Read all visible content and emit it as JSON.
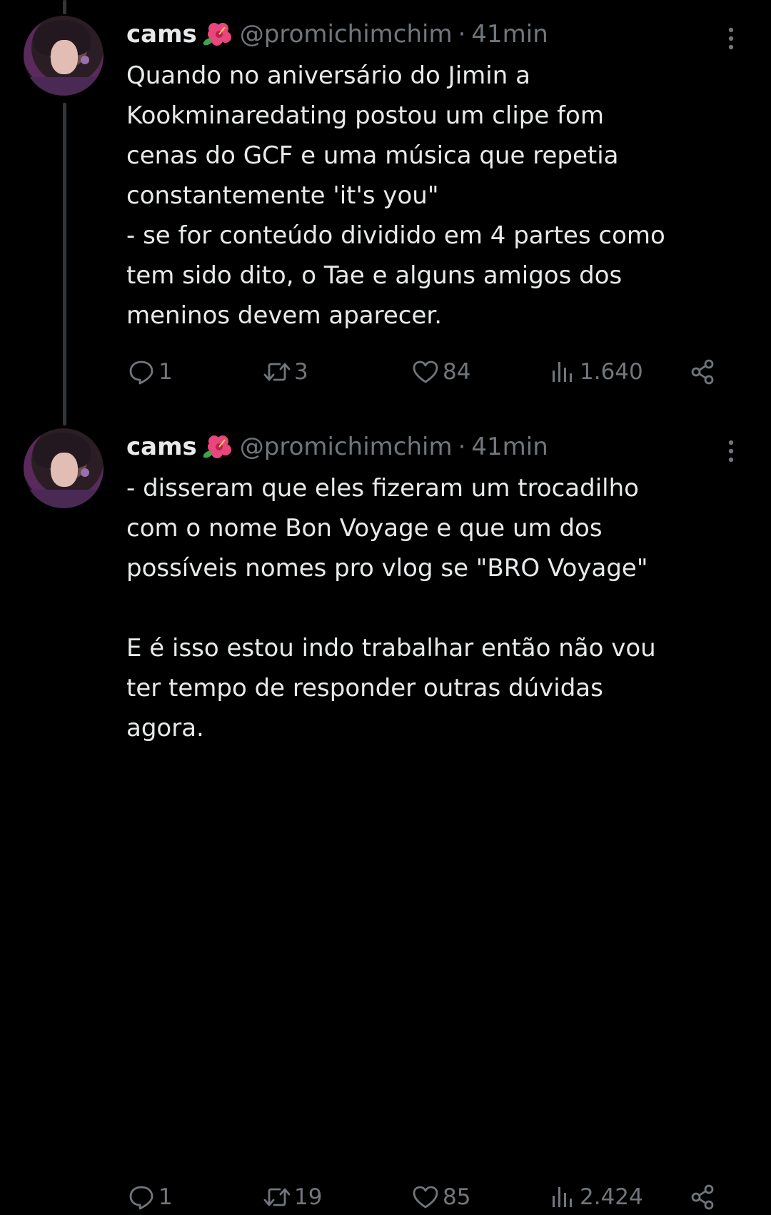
{
  "tweets": [
    {
      "display_name": "cams",
      "handle": "@promichimchim",
      "separator": "·",
      "time": "41min",
      "text": "Quando no aniversário do Jimin a\nKookminaredating postou um clipe fom\ncenas do GCF e uma música que repetia\nconstantemente 'it's you\"\n- se for conteúdo dividido em 4 partes como\ntem sido dito, o Tae e alguns amigos dos\nmeninos devem aparecer.",
      "replies": "1",
      "reposts": "3",
      "likes": "84",
      "views": "1.640"
    },
    {
      "display_name": "cams",
      "handle": "@promichimchim",
      "separator": "·",
      "time": "41min",
      "text": "- disseram que eles fizeram um trocadilho\ncom o nome Bon Voyage e que um dos\npossíveis nomes pro vlog se \"BRO Voyage\"\n\nE é isso estou indo trabalhar então não vou\nter tempo de responder outras dúvidas\nagora.",
      "replies": "1",
      "reposts": "19",
      "likes": "85",
      "views": "2.424"
    }
  ],
  "icons": {
    "name_emoji": "hibiscus-icon",
    "more": "more-vertical-icon",
    "reply": "reply-icon",
    "repost": "repost-icon",
    "like": "heart-icon",
    "views": "views-icon",
    "share": "share-icon"
  },
  "colors": {
    "background": "#000000",
    "text_primary": "#e7e9ea",
    "text_secondary": "#71767b",
    "thread_line": "#333639",
    "hibiscus": "#e8467c"
  }
}
